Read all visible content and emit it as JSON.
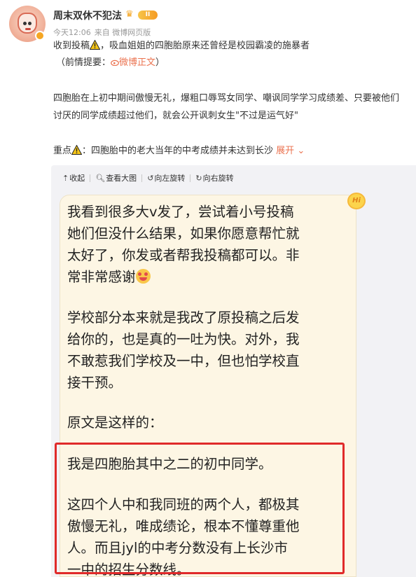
{
  "header": {
    "username": "周末双休不犯法",
    "vip_level": "II",
    "time": "今天12:06",
    "source": "来自 微博网页版"
  },
  "post": {
    "line1_prefix": "收到投稿",
    "line1_suffix": "，吸血姐姐的四胞胎原来还曾经是校园霸凌的施暴者",
    "line2_prefix": "（前情提要：",
    "line2_link": "微博正文",
    "line2_suffix": "）",
    "para1_line1": "四胞胎在上初中期间傲慢无礼，爆粗口辱骂女同学、嘲讽同学学习成绩差、只要被他们",
    "para1_line2": "讨厌的同学成绩超过他们，就会公开讽刺女生\"不过是运气好\"",
    "key_prefix": "重点",
    "key_text": "：四胞胎中的老大当年的中考成绩并未达到长沙",
    "expand_label": "展开"
  },
  "toolbar": {
    "collapse": "收起",
    "view_large": "查看大图",
    "rotate_left": "向左旋转",
    "rotate_right": "向右旋转"
  },
  "image_text": {
    "badge": "Hi",
    "lines": [
      "我看到很多大v发了，尝试着小号投稿",
      "她们但没什么结果，如果你愿意帮忙就",
      "太好了，你发或者帮我投稿都可以。非",
      "常非常感谢",
      "学校部分本来就是我改了原投稿之后发",
      "给你的，也是真的一吐为快。对外，我",
      "不敢惹我们学校及一中，但也怕学校直",
      "接干预。",
      "原文是这样的：",
      "我是四胞胎其中之二的初中同学。",
      "这四个人中和我同班的两个人，都极其",
      "傲慢无礼，唯成绩论，根本不懂尊重他",
      "人。而且jyl的中考分数没有上长沙市",
      "一中的招生分数线。"
    ]
  },
  "colors": {
    "accent": "#eb7350",
    "highlight_border": "#e02a2a",
    "note_bg": "#fdf6e4"
  },
  "icons": [
    "warning-icon",
    "weibo-icon",
    "chevron-down-icon",
    "collapse-icon",
    "zoom-icon",
    "rotate-left-icon",
    "rotate-right-icon",
    "smiling-hearts-emoji"
  ]
}
